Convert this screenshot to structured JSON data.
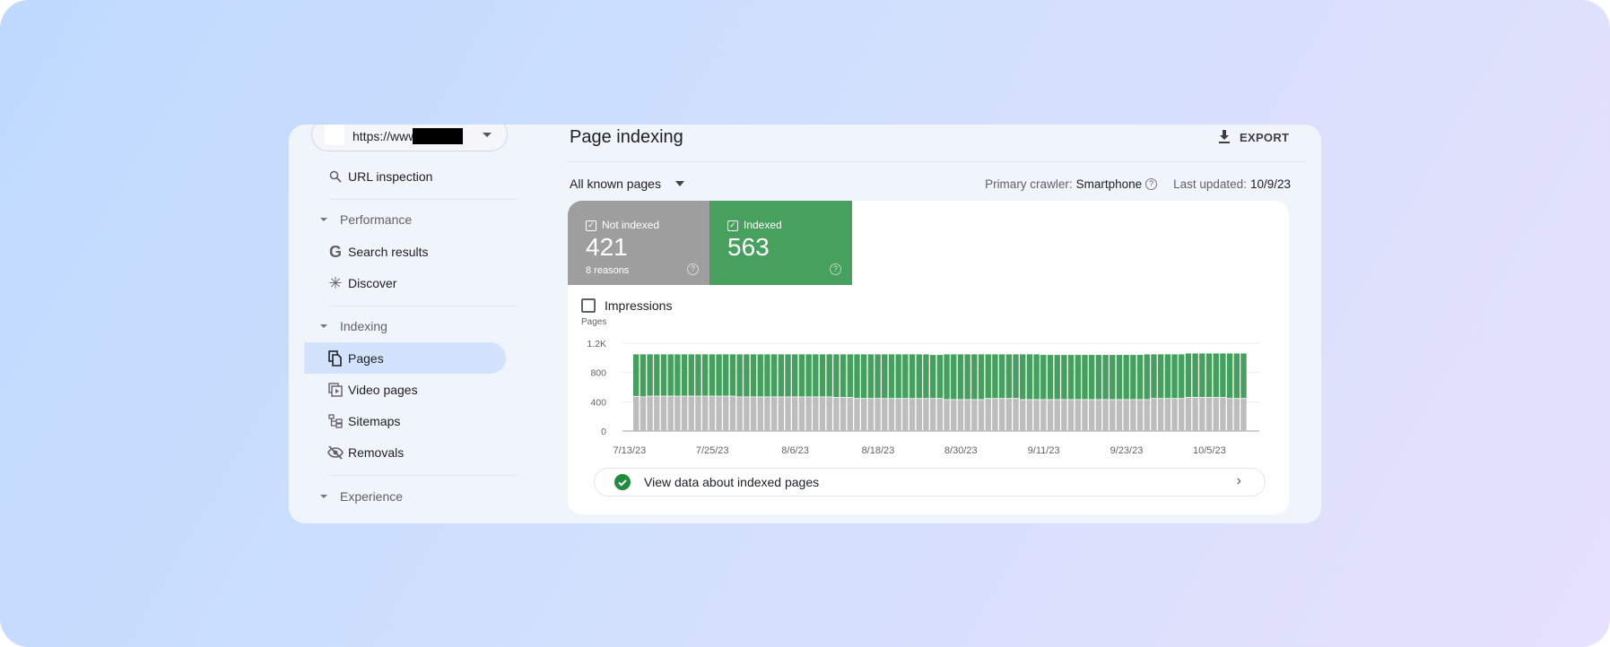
{
  "property": {
    "url": "https://www"
  },
  "sidebar": {
    "url_inspection": "URL inspection",
    "sections": [
      {
        "label": "Performance",
        "items": [
          "Search results",
          "Discover"
        ]
      },
      {
        "label": "Indexing",
        "items": [
          "Pages",
          "Video pages",
          "Sitemaps",
          "Removals"
        ]
      },
      {
        "label": "Experience",
        "items": []
      }
    ],
    "active": "Pages"
  },
  "header": {
    "title": "Page indexing",
    "export": "EXPORT"
  },
  "filter": {
    "selected": "All known pages",
    "crawler_label": "Primary crawler:",
    "crawler_value": "Smartphone",
    "updated_label": "Last updated:",
    "updated_value": "10/9/23"
  },
  "tiles": [
    {
      "label": "Not indexed",
      "value": "421",
      "sub": "8 reasons",
      "color": "#9e9e9e"
    },
    {
      "label": "Indexed",
      "value": "563",
      "sub": "",
      "color": "#48a05e"
    }
  ],
  "impressions_label": "Impressions",
  "view_data": "View data about indexed pages",
  "chart_data": {
    "type": "bar",
    "stacked": true,
    "ylabel": "Pages",
    "ylim": [
      0,
      1200
    ],
    "yticks": [
      {
        "v": 0,
        "l": "0"
      },
      {
        "v": 400,
        "l": "400"
      },
      {
        "v": 800,
        "l": "800"
      },
      {
        "v": 1200,
        "l": "1.2K"
      }
    ],
    "xtick_labels": [
      "7/13/23",
      "7/25/23",
      "8/6/23",
      "8/18/23",
      "8/30/23",
      "9/11/23",
      "9/23/23",
      "10/5/23"
    ],
    "x": [
      "7/13/23",
      "7/14/23",
      "7/15/23",
      "7/16/23",
      "7/17/23",
      "7/18/23",
      "7/19/23",
      "7/20/23",
      "7/21/23",
      "7/22/23",
      "7/23/23",
      "7/24/23",
      "7/25/23",
      "7/26/23",
      "7/27/23",
      "7/28/23",
      "7/29/23",
      "7/30/23",
      "7/31/23",
      "8/1/23",
      "8/2/23",
      "8/3/23",
      "8/4/23",
      "8/5/23",
      "8/6/23",
      "8/7/23",
      "8/8/23",
      "8/9/23",
      "8/10/23",
      "8/11/23",
      "8/12/23",
      "8/13/23",
      "8/14/23",
      "8/15/23",
      "8/16/23",
      "8/17/23",
      "8/18/23",
      "8/19/23",
      "8/20/23",
      "8/21/23",
      "8/22/23",
      "8/23/23",
      "8/24/23",
      "8/25/23",
      "8/26/23",
      "8/27/23",
      "8/28/23",
      "8/29/23",
      "8/30/23",
      "8/31/23",
      "9/1/23",
      "9/2/23",
      "9/3/23",
      "9/4/23",
      "9/5/23",
      "9/6/23",
      "9/7/23",
      "9/8/23",
      "9/9/23",
      "9/10/23",
      "9/11/23",
      "9/12/23",
      "9/13/23",
      "9/14/23",
      "9/15/23",
      "9/16/23",
      "9/17/23",
      "9/18/23",
      "9/19/23",
      "9/20/23",
      "9/21/23",
      "9/22/23",
      "9/23/23",
      "9/24/23",
      "9/25/23",
      "9/26/23",
      "9/27/23",
      "9/28/23",
      "9/29/23",
      "9/30/23",
      "10/1/23",
      "10/2/23",
      "10/3/23",
      "10/4/23",
      "10/5/23",
      "10/6/23",
      "10/7/23",
      "10/8/23",
      "10/9/23"
    ],
    "series": [
      {
        "name": "Not indexed",
        "color": "#bdbdbd",
        "values": [
          470,
          462,
          472,
          472,
          472,
          472,
          472,
          472,
          472,
          472,
          472,
          472,
          472,
          472,
          472,
          462,
          462,
          462,
          462,
          462,
          462,
          462,
          462,
          462,
          462,
          462,
          462,
          462,
          462,
          455,
          455,
          455,
          440,
          440,
          440,
          440,
          440,
          440,
          440,
          440,
          440,
          440,
          440,
          440,
          440,
          425,
          425,
          425,
          425,
          425,
          425,
          440,
          440,
          440,
          440,
          440,
          425,
          425,
          425,
          425,
          425,
          425,
          425,
          425,
          425,
          425,
          425,
          425,
          425,
          425,
          425,
          425,
          425,
          425,
          425,
          440,
          440,
          440,
          440,
          440,
          455,
          455,
          455,
          455,
          455,
          455,
          440,
          440,
          440
        ]
      },
      {
        "name": "Indexed",
        "color": "#43a15d",
        "values": [
          578,
          586,
          576,
          576,
          576,
          576,
          576,
          576,
          576,
          576,
          576,
          576,
          576,
          576,
          576,
          586,
          586,
          586,
          586,
          586,
          586,
          586,
          586,
          586,
          586,
          586,
          586,
          586,
          586,
          593,
          593,
          593,
          608,
          608,
          608,
          608,
          608,
          608,
          608,
          608,
          608,
          608,
          608,
          600,
          600,
          623,
          623,
          623,
          623,
          623,
          623,
          608,
          608,
          608,
          608,
          608,
          623,
          623,
          623,
          615,
          615,
          615,
          615,
          615,
          615,
          615,
          615,
          615,
          615,
          615,
          615,
          615,
          615,
          615,
          623,
          608,
          608,
          608,
          608,
          608,
          605,
          605,
          605,
          605,
          605,
          605,
          620,
          620,
          620
        ]
      }
    ]
  }
}
